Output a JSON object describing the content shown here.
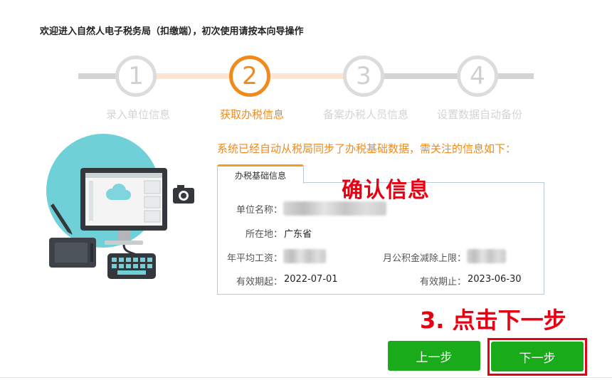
{
  "header": {
    "title": "欢迎进入自然人电子税务局（扣缴端），初次使用请按本向导操作"
  },
  "steps": [
    {
      "number": "1",
      "label": "录入单位信息",
      "state": "done"
    },
    {
      "number": "2",
      "label": "获取办税信息",
      "state": "active"
    },
    {
      "number": "3",
      "label": "备案办税人员信息",
      "state": "pending"
    },
    {
      "number": "4",
      "label": "设置数据自动备份",
      "state": "pending"
    }
  ],
  "notice": "系统已经自动从税局同步了办税基础数据，需关注的信息如下：",
  "card": {
    "tab_label": "办税基础信息",
    "fields": {
      "unit_name_label": "单位名称：",
      "location_label": "所在地：",
      "location_value": "广东省",
      "avg_salary_label": "年平均工资：",
      "fund_limit_label": "月公积金减除上限：",
      "valid_from_label": "有效期起：",
      "valid_from_value": "2022-07-01",
      "valid_to_label": "有效期止：",
      "valid_to_value": "2023-06-30"
    }
  },
  "annotations": {
    "confirm": "确认信息",
    "click_next": "3. 点击下一步"
  },
  "buttons": {
    "prev": "上一步",
    "next": "下一步"
  },
  "colors": {
    "accent": "#f08a1c",
    "button": "#1aab1a",
    "annotation": "#e60012",
    "illustration_circle": "#6fd0d8"
  },
  "icons": [
    "computer-illustration",
    "cloud-icon",
    "camera-icon",
    "pen-icon",
    "tablet-icon",
    "keyboard-icon"
  ]
}
